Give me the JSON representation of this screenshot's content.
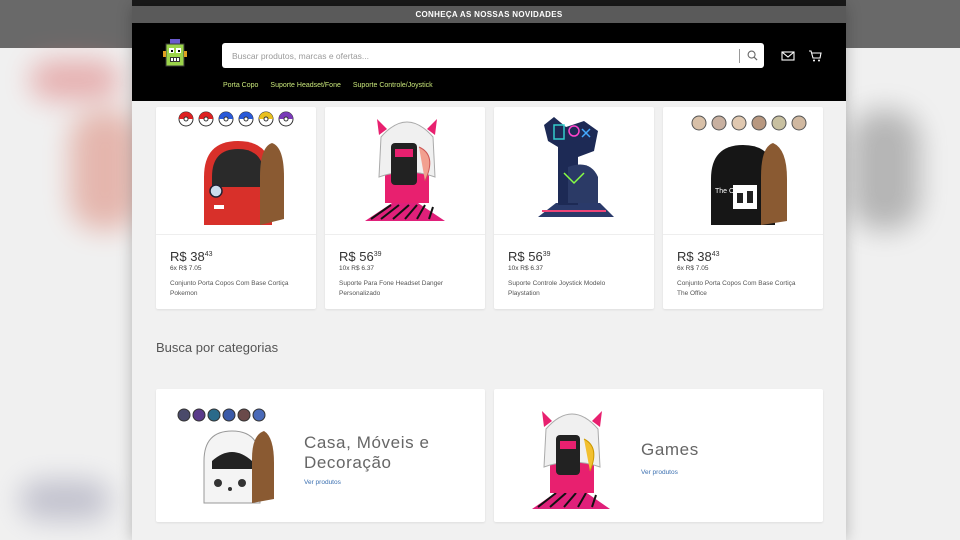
{
  "announcement": "CONHEÇA AS NOSSAS NOVIDADES",
  "search": {
    "placeholder": "Buscar produtos, marcas e ofertas..."
  },
  "nav": [
    "Porta Copo",
    "Suporte Headset/Fone",
    "Suporte Controle/Joystick"
  ],
  "products": [
    {
      "currency": "R$",
      "int": "38",
      "cents": "43",
      "installments": "6x R$ 7.05",
      "title": "Conjunto Porta Copos Com Base Cortiça Pokemon"
    },
    {
      "currency": "R$",
      "int": "56",
      "cents": "39",
      "installments": "10x R$ 6.37",
      "title": "Suporte Para Fone Headset Danger Personalizado"
    },
    {
      "currency": "R$",
      "int": "56",
      "cents": "39",
      "installments": "10x R$ 6.37",
      "title": "Suporte Controle Joystick Modelo Playstation"
    },
    {
      "currency": "R$",
      "int": "38",
      "cents": "43",
      "installments": "6x R$ 7.05",
      "title": "Conjunto Porta Copos Com Base Cortiça The Office"
    }
  ],
  "product_art": {
    "office_label": "The Office"
  },
  "categories_heading": "Busca por categorias",
  "categories": [
    {
      "name_line1": "Casa, Móveis e",
      "name_line2": "Decoração",
      "link": "Ver produtos"
    },
    {
      "name_line1": "Games",
      "name_line2": "",
      "link": "Ver produtos"
    }
  ],
  "colors": {
    "nav_link": "#c9e77a",
    "header_bg": "#000000",
    "topbar_bg": "#5a5a5a",
    "link": "#3a6fb0"
  },
  "icons": {
    "search": "search-icon",
    "mail": "mail-icon",
    "cart": "cart-icon",
    "logo": "robot-logo-icon"
  }
}
